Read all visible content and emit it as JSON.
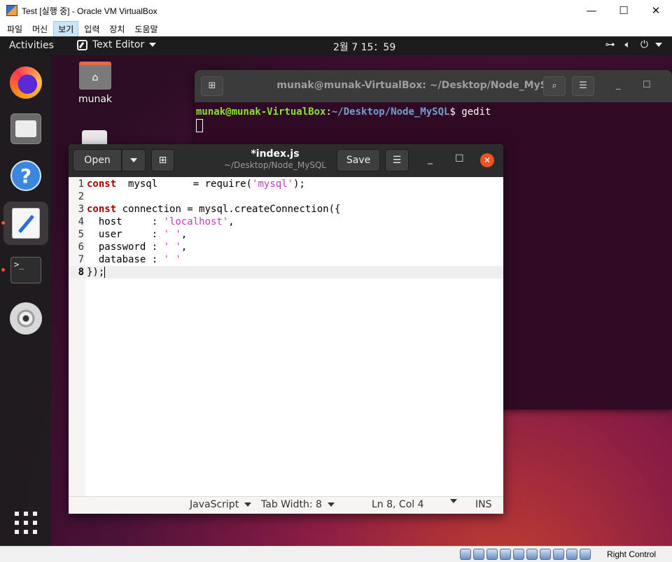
{
  "host_window": {
    "title": "Test [실행 중] - Oracle VM VirtualBox",
    "menu": [
      "파일",
      "머신",
      "보기",
      "입력",
      "장치",
      "도움말"
    ],
    "active_menu_index": 2,
    "controls": {
      "minimize": "—",
      "maximize": "☐",
      "close": "✕"
    }
  },
  "topbar": {
    "activities": "Activities",
    "app_name": "Text Editor",
    "clock": "2월 7  15：59",
    "tray_icons": [
      "network-icon",
      "volume-icon",
      "power-icon"
    ]
  },
  "dock": {
    "apps": [
      "firefox-icon",
      "files-icon",
      "help-icon",
      "text-editor-icon",
      "terminal-icon",
      "dvd-icon"
    ],
    "active_app": "text-editor-icon",
    "running_apps": [
      "text-editor-icon",
      "terminal-icon"
    ],
    "show_apps": "show-applications-icon"
  },
  "desktop": {
    "home_label": "munak",
    "home_glyph": "⌂"
  },
  "terminal": {
    "title": "munak@munak-VirtualBox: ~/Desktop/Node_MySQL",
    "prompt_user": "munak@munak-VirtualBox",
    "prompt_sep": ":",
    "prompt_path": "~/Desktop/Node_MySQL",
    "prompt_command": "$ gedit",
    "newtab_glyph": "⊞",
    "search_glyph": "⌕",
    "menu_glyph": "☰",
    "min_glyph": "_",
    "max_glyph": "☐",
    "close_glyph": "✕"
  },
  "gedit": {
    "open_label": "Open",
    "save_label": "Save",
    "title": "*index.js",
    "subtitle": "~/Desktop/Node_MySQL",
    "newtab_glyph": "⊞",
    "menu_glyph": "☰",
    "min_glyph": "_",
    "max_glyph": "☐",
    "close_glyph": "✕",
    "current_line": 8,
    "lines": [
      {
        "n": "1",
        "segs": [
          [
            "kw",
            "const"
          ],
          [
            "",
            "  mysql      = require("
          ],
          [
            "str",
            "'mysql'"
          ],
          [
            "",
            ");"
          ]
        ]
      },
      {
        "n": "2",
        "segs": []
      },
      {
        "n": "3",
        "segs": [
          [
            "kw",
            "const"
          ],
          [
            "",
            " connection = mysql.createConnection({"
          ]
        ]
      },
      {
        "n": "4",
        "segs": [
          [
            "",
            "  host     : "
          ],
          [
            "str",
            "'localhost'"
          ],
          [
            "",
            ","
          ]
        ]
      },
      {
        "n": "5",
        "segs": [
          [
            "",
            "  user     : "
          ],
          [
            "str",
            "' '"
          ],
          [
            "",
            ","
          ]
        ]
      },
      {
        "n": "6",
        "segs": [
          [
            "",
            "  password : "
          ],
          [
            "str",
            "' '"
          ],
          [
            "",
            ","
          ]
        ]
      },
      {
        "n": "7",
        "segs": [
          [
            "",
            "  database : "
          ],
          [
            "str",
            "' '"
          ]
        ]
      },
      {
        "n": "8",
        "segs": [
          [
            "",
            "});"
          ]
        ]
      }
    ],
    "status": {
      "language": "JavaScript",
      "tab_width": "Tab Width: 8",
      "position": "Ln 8, Col 4",
      "mode": "INS"
    }
  },
  "vbox_status": {
    "host_key": "Right Control"
  },
  "colors": {
    "ubuntu_orange": "#e95420",
    "terminal_bg": "#300a24",
    "prompt_green": "#8ae234",
    "prompt_blue": "#729fcf",
    "keyword": "#a40000",
    "string": "#c33bc2"
  }
}
